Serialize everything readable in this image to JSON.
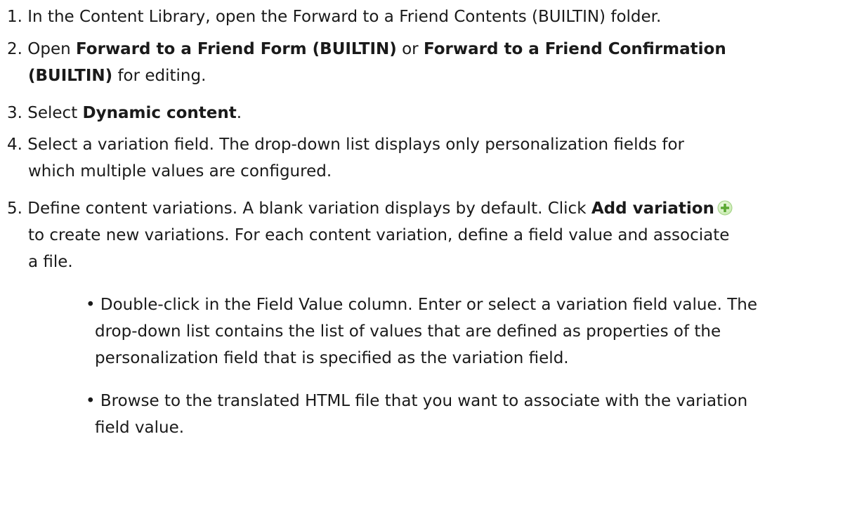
{
  "steps": [
    {
      "num": "1.",
      "text": "In the Content Library, open the Forward to a Friend Contents (BUILTIN) folder."
    },
    {
      "num": "2.",
      "pre": "Open ",
      "bold1": "Forward to a Friend Form (BUILTIN)",
      "mid": " or ",
      "bold2a": "Forward to a Friend Confirmation",
      "bold2b": "(BUILTIN)",
      "post": " for editing."
    },
    {
      "num": "3.",
      "pre": "Select ",
      "bold": "Dynamic content",
      "post": "."
    },
    {
      "num": "4.",
      "line1": "Select a variation field. The drop-down list displays only personalization fields for",
      "line2": "which multiple values are configured."
    },
    {
      "num": "5.",
      "pre": "Define content variations. A blank variation displays by default. Click ",
      "bold": "Add variation",
      "icon": "add-variation-icon",
      "line2": "to create new variations. For each content variation, define a field value and associate",
      "line3": "a file."
    }
  ],
  "bullets": [
    {
      "marker": "•",
      "line1": "Double-click in the Field Value column. Enter or select a variation field value. The",
      "line2": "drop-down list contains the list of values that are defined as properties of the",
      "line3": "personalization field that is specified as the variation field."
    },
    {
      "marker": "•",
      "line1": "Browse to the translated HTML file that you want to associate with the variation",
      "line2": "field value."
    }
  ],
  "colors": {
    "text": "#1a1a1a",
    "icon_green": "#5aa832",
    "icon_green_light": "#c9ebb0"
  }
}
